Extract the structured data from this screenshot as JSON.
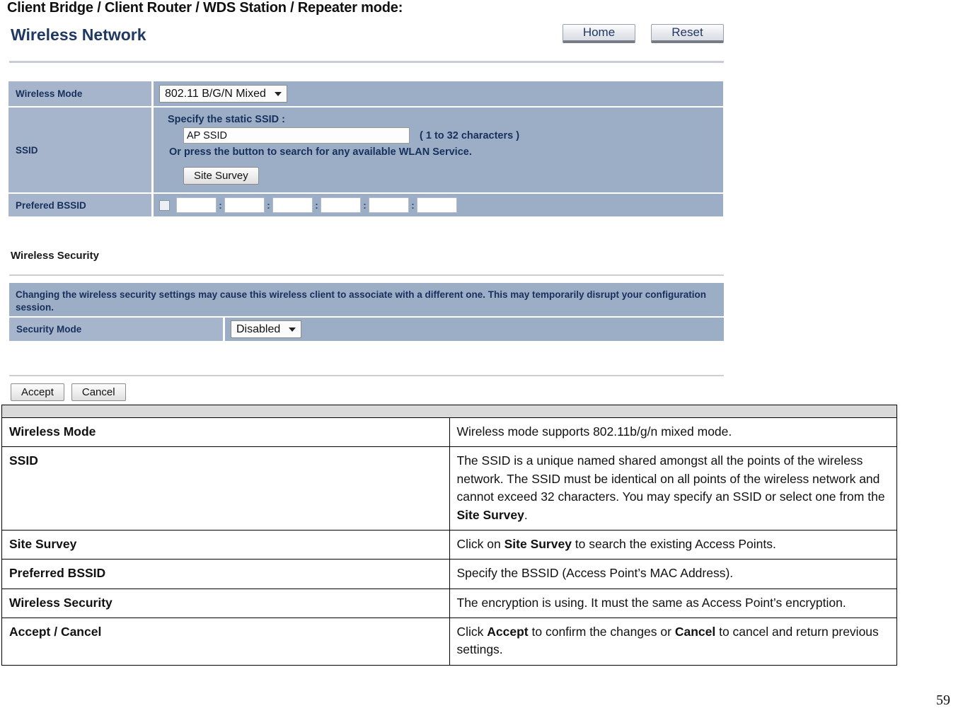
{
  "page": {
    "heading": "Client Bridge / Client Router / WDS Station / Repeater mode:",
    "page_number": "59"
  },
  "router_ui": {
    "title": "Wireless Network",
    "top_buttons": {
      "home": "Home",
      "reset": "Reset"
    },
    "wireless_mode": {
      "label": "Wireless Mode",
      "value": "802.11 B/G/N Mixed"
    },
    "ssid": {
      "label": "SSID",
      "prompt": "Specify the static SSID  :",
      "input_value": "AP SSID",
      "hint": "( 1 to 32 characters )",
      "or_text": "Or press the button to search for any available WLAN Service.",
      "site_survey_button": "Site Survey"
    },
    "prefered_bssid": {
      "label": "Prefered BSSID",
      "mac_fields": [
        "",
        "",
        "",
        "",
        "",
        ""
      ],
      "separator": ":"
    },
    "wireless_security": {
      "heading": "Wireless Security",
      "warning": "Changing the wireless security settings may cause this wireless client to associate with a different one. This may temporarily disrupt your configuration session.",
      "security_mode_label": "Security Mode",
      "security_mode_value": "Disabled"
    },
    "actions": {
      "accept": "Accept",
      "cancel": "Cancel"
    },
    "colors": {
      "label_cell": "#a6b5cb",
      "value_cell": "#9cadc6",
      "title_blue": "#1f3864",
      "label_text": "#17305c"
    }
  },
  "description_table": {
    "rows": [
      {
        "term": "Wireless Mode",
        "desc_parts": [
          {
            "text": "Wireless mode supports 802.11b/g/n mixed mode.",
            "bold": false
          }
        ]
      },
      {
        "term": "SSID",
        "desc_parts": [
          {
            "text": "The SSID is a unique named shared amongst all the points of the wireless network. The SSID must be identical on all points of the wireless network and cannot exceed 32 characters. You may specify an SSID or select one from the ",
            "bold": false
          },
          {
            "text": "Site Survey",
            "bold": true
          },
          {
            "text": ".",
            "bold": false
          }
        ]
      },
      {
        "term": "Site Survey",
        "desc_parts": [
          {
            "text": "Click on ",
            "bold": false
          },
          {
            "text": "Site Survey",
            "bold": true
          },
          {
            "text": " to search the existing Access Points.",
            "bold": false
          }
        ]
      },
      {
        "term": "Preferred BSSID",
        "desc_parts": [
          {
            "text": "Specify the BSSID (Access Point’s MAC Address).",
            "bold": false
          }
        ]
      },
      {
        "term": "Wireless Security",
        "desc_parts": [
          {
            "text": "The encryption is using. It must the same as Access Point’s encryption.",
            "bold": false
          }
        ]
      },
      {
        "term": "Accept / Cancel",
        "desc_parts": [
          {
            "text": "Click ",
            "bold": false
          },
          {
            "text": "Accept",
            "bold": true
          },
          {
            "text": " to confirm the changes or ",
            "bold": false
          },
          {
            "text": "Cancel",
            "bold": true
          },
          {
            "text": " to cancel and return previous settings.",
            "bold": false
          }
        ]
      }
    ]
  }
}
